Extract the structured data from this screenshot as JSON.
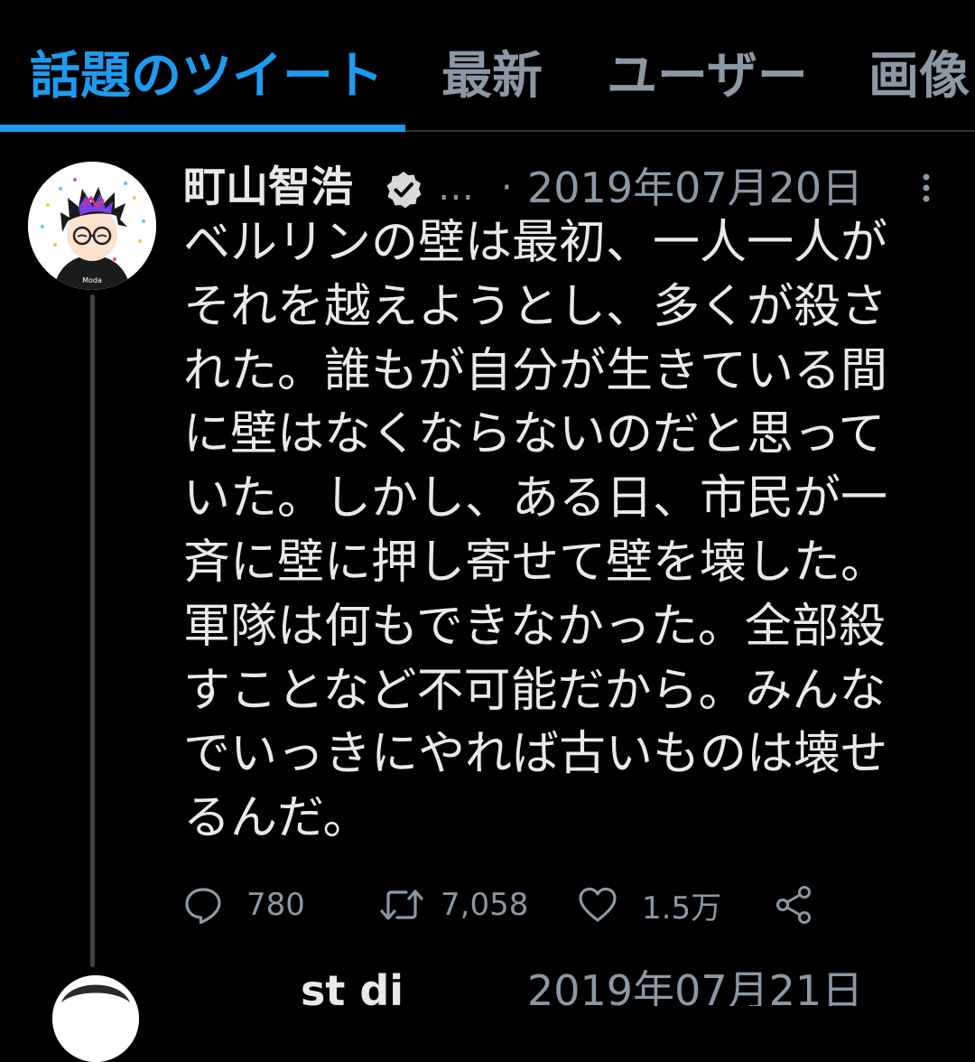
{
  "tabs": [
    {
      "label": "話題のツイート",
      "active": true
    },
    {
      "label": "最新",
      "active": false
    },
    {
      "label": "ユーザー",
      "active": false
    },
    {
      "label": "画像",
      "active": false
    }
  ],
  "tweet": {
    "author_name": "町山智浩",
    "verified": true,
    "handle_truncated": "…",
    "separator": "·",
    "timestamp": "2019年07月20日",
    "text_lines": [
      "ベルリンの壁は最初、一人一人が",
      "それを越えようとし、多くが殺さ",
      "れた。誰もが自分が生きている間",
      "に壁はなくならないのだと思って",
      "いた。しかし、ある日、市民が一",
      "斉に壁に押し寄せて壁を壊した。",
      "軍隊は何もできなかった。全部殺",
      "すことなど不可能だから。みんな",
      "でいっきにやれば古いものは壊せ",
      "るんだ。"
    ],
    "replies": "780",
    "retweets": "7,058",
    "likes": "1.5万"
  },
  "next_tweet": {
    "author_name": "st  di",
    "timestamp": "2019年07月21日"
  },
  "colors": {
    "background": "#000000",
    "accent": "#1d9bf0",
    "text_primary": "#e7e9ea",
    "text_secondary": "#8b98a5",
    "divider": "#2f3336"
  },
  "icons": {
    "reply": "reply-icon",
    "retweet": "retweet-icon",
    "like": "heart-icon",
    "share": "share-icon",
    "verified": "verified-badge-icon",
    "more": "more-vertical-icon"
  }
}
